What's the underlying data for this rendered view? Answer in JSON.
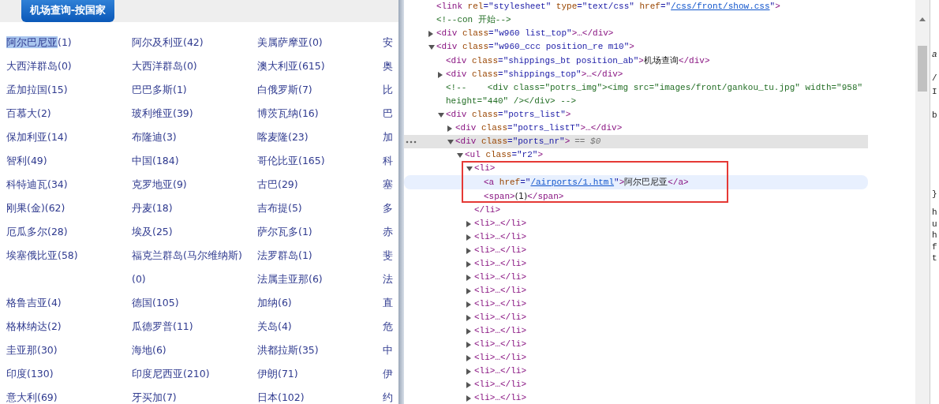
{
  "page": {
    "title_tab": "机场查询-按国家",
    "countries": [
      {
        "name": "阿尔巴尼亚",
        "count": "(1)",
        "selected": true
      },
      {
        "name": "阿尔及利亚",
        "count": "(42)",
        "selected": false
      },
      {
        "name": "美属萨摩亚",
        "count": "(0)",
        "selected": false
      },
      {
        "name": "安",
        "selected": false
      },
      {
        "name": "大西洋群岛",
        "count": "(0)",
        "selected": false
      },
      {
        "name": "大西洋群岛",
        "count": "(0)",
        "selected": false
      },
      {
        "name": "澳大利亚",
        "count": "(615)",
        "selected": false
      },
      {
        "name": "奥",
        "selected": false
      },
      {
        "name": "孟加拉国",
        "count": "(15)",
        "selected": false
      },
      {
        "name": "巴巴多斯",
        "count": "(1)",
        "selected": false
      },
      {
        "name": "白俄罗斯",
        "count": "(7)",
        "selected": false
      },
      {
        "name": "比",
        "selected": false
      },
      {
        "name": "百慕大",
        "count": "(2)",
        "selected": false
      },
      {
        "name": "玻利维亚",
        "count": "(39)",
        "selected": false
      },
      {
        "name": "博茨瓦纳",
        "count": "(16)",
        "selected": false
      },
      {
        "name": "巴",
        "selected": false
      },
      {
        "name": "保加利亚",
        "count": "(14)",
        "selected": false
      },
      {
        "name": "布隆迪",
        "count": "(3)",
        "selected": false
      },
      {
        "name": "喀麦隆",
        "count": "(23)",
        "selected": false
      },
      {
        "name": "加",
        "selected": false
      },
      {
        "name": "智利",
        "count": "(49)",
        "selected": false
      },
      {
        "name": "中国",
        "count": "(184)",
        "selected": false
      },
      {
        "name": "哥伦比亚",
        "count": "(165)",
        "selected": false
      },
      {
        "name": "科",
        "selected": false
      },
      {
        "name": "科特迪瓦",
        "count": "(34)",
        "selected": false
      },
      {
        "name": "克罗地亚",
        "count": "(9)",
        "selected": false
      },
      {
        "name": "古巴",
        "count": "(29)",
        "selected": false
      },
      {
        "name": "塞",
        "selected": false
      },
      {
        "name": "刚果(金)",
        "count": "(62)",
        "selected": false
      },
      {
        "name": "丹麦",
        "count": "(18)",
        "selected": false
      },
      {
        "name": "吉布提",
        "count": "(5)",
        "selected": false
      },
      {
        "name": "多",
        "selected": false
      },
      {
        "name": "厄瓜多尔",
        "count": "(28)",
        "selected": false
      },
      {
        "name": "埃及",
        "count": "(25)",
        "selected": false
      },
      {
        "name": "萨尔瓦多",
        "count": "(1)",
        "selected": false
      },
      {
        "name": "赤",
        "selected": false
      },
      {
        "name": "埃塞俄比亚",
        "count": "(58)",
        "selected": false
      },
      {
        "name": "福克兰群岛(马尔维纳斯)",
        "count": "(0)",
        "selected": false
      },
      {
        "name": "法罗群岛",
        "count": "(1)",
        "selected": false
      },
      {
        "name": "斐",
        "selected": false
      },
      {
        "name": "法属圭亚那",
        "count": "(6)",
        "selected": false
      },
      {
        "name": "法",
        "selected": false
      },
      {
        "name": "格鲁吉亚",
        "count": "(4)",
        "selected": false
      },
      {
        "name": "德国",
        "count": "(105)",
        "selected": false
      },
      {
        "name": "加纳",
        "count": "(6)",
        "selected": false
      },
      {
        "name": "直",
        "selected": false
      },
      {
        "name": "格林纳达",
        "count": "(2)",
        "selected": false
      },
      {
        "name": "瓜德罗普",
        "count": "(11)",
        "selected": false
      },
      {
        "name": "关岛",
        "count": "(4)",
        "selected": false
      },
      {
        "name": "危",
        "selected": false
      },
      {
        "name": "圭亚那",
        "count": "(30)",
        "selected": false
      },
      {
        "name": "海地",
        "count": "(6)",
        "selected": false
      },
      {
        "name": "洪都拉斯",
        "count": "(35)",
        "selected": false
      },
      {
        "name": "中",
        "selected": false
      },
      {
        "name": "印度",
        "count": "(130)",
        "selected": false
      },
      {
        "name": "印度尼西亚",
        "count": "(210)",
        "selected": false
      },
      {
        "name": "伊朗",
        "count": "(71)",
        "selected": false
      },
      {
        "name": "伊",
        "selected": false
      },
      {
        "name": "意大利",
        "count": "(69)",
        "selected": false
      },
      {
        "name": "牙买加",
        "count": "(7)",
        "selected": false
      },
      {
        "name": "日本",
        "count": "(102)",
        "selected": false
      },
      {
        "name": "约",
        "selected": false
      }
    ]
  },
  "devtools": {
    "dom": [
      {
        "kind": "element",
        "selected": false,
        "hovered": false,
        "parts": [
          {
            "kind": "tag",
            "text": "<link "
          },
          {
            "kind": "name",
            "text": "rel"
          },
          {
            "kind": "val",
            "text": "=\"stylesheet\""
          },
          {
            "kind": "name",
            "text": " type"
          },
          {
            "kind": "val",
            "text": "=\"text/css\""
          },
          {
            "kind": "name",
            "text": " href"
          },
          {
            "kind": "val",
            "text": "=\""
          },
          {
            "kind": "link",
            "text": "/css/front/show.css"
          },
          {
            "kind": "val",
            "text": "\""
          },
          {
            "kind": "tag",
            "text": ">"
          }
        ]
      },
      {
        "kind": "comment",
        "selected": false,
        "hovered": false,
        "parts": [
          {
            "kind": "comment",
            "text": "<!--con 开始-->"
          }
        ]
      },
      {
        "kind": "element",
        "expanded": false,
        "selected": false,
        "hovered": false,
        "parts": [
          {
            "kind": "tag",
            "text": "<div "
          },
          {
            "kind": "name",
            "text": "class"
          },
          {
            "kind": "val",
            "text": "=\"w960 list_top\""
          },
          {
            "kind": "tag",
            "text": ">…</div>"
          }
        ]
      },
      {
        "kind": "element",
        "expanded": true,
        "selected": false,
        "hovered": false,
        "parts": [
          {
            "kind": "tag",
            "text": "<div "
          },
          {
            "kind": "name",
            "text": "class"
          },
          {
            "kind": "val",
            "text": "=\"w960_ccc position_re m10\""
          },
          {
            "kind": "tag",
            "text": ">"
          }
        ],
        "children": [
          {
            "kind": "element",
            "selected": false,
            "hovered": false,
            "parts": [
              {
                "kind": "tag",
                "text": "<div "
              },
              {
                "kind": "name",
                "text": "class"
              },
              {
                "kind": "val",
                "text": "=\"shippings_bt position_ab\""
              },
              {
                "kind": "tag",
                "text": ">"
              },
              {
                "kind": "text",
                "text": "机场查询"
              },
              {
                "kind": "tag",
                "text": "</div>"
              }
            ]
          },
          {
            "kind": "element",
            "expanded": false,
            "selected": false,
            "hovered": false,
            "parts": [
              {
                "kind": "tag",
                "text": "<div "
              },
              {
                "kind": "name",
                "text": "class"
              },
              {
                "kind": "val",
                "text": "=\"shippings_top\""
              },
              {
                "kind": "tag",
                "text": ">…</div>"
              }
            ]
          },
          {
            "kind": "comment",
            "selected": false,
            "hovered": false,
            "parts": [
              {
                "kind": "comment",
                "text": "<!--    <div class=\"potrs_img\"><img src=\"images/front/gankou_tu.jpg\" width=\"958\" height=\"440\" /></div> -->"
              }
            ]
          },
          {
            "kind": "element",
            "expanded": true,
            "selected": false,
            "hovered": false,
            "parts": [
              {
                "kind": "tag",
                "text": "<div "
              },
              {
                "kind": "name",
                "text": "class"
              },
              {
                "kind": "val",
                "text": "=\"potrs_list\""
              },
              {
                "kind": "tag",
                "text": ">"
              }
            ],
            "children": [
              {
                "kind": "element",
                "expanded": false,
                "selected": false,
                "hovered": false,
                "parts": [
                  {
                    "kind": "tag",
                    "text": "<div "
                  },
                  {
                    "kind": "name",
                    "text": "class"
                  },
                  {
                    "kind": "val",
                    "text": "=\"potrs_listT\""
                  },
                  {
                    "kind": "tag",
                    "text": ">…</div>"
                  }
                ]
              },
              {
                "kind": "element",
                "expanded": true,
                "selected": true,
                "hovered": false,
                "suffix": "== $0",
                "parts": [
                  {
                    "kind": "tag",
                    "text": "<div "
                  },
                  {
                    "kind": "name",
                    "text": "class"
                  },
                  {
                    "kind": "val",
                    "text": "=\"ports_nr\""
                  },
                  {
                    "kind": "tag",
                    "text": ">"
                  }
                ],
                "children": [
                  {
                    "kind": "element",
                    "expanded": true,
                    "selected": false,
                    "hovered": false,
                    "parts": [
                      {
                        "kind": "tag",
                        "text": "<ul "
                      },
                      {
                        "kind": "name",
                        "text": "class"
                      },
                      {
                        "kind": "val",
                        "text": "=\"r2\""
                      },
                      {
                        "kind": "tag",
                        "text": ">"
                      }
                    ],
                    "children": [
                      {
                        "kind": "element",
                        "expanded": true,
                        "selected": false,
                        "hovered": false,
                        "highlighted": true,
                        "parts": [
                          {
                            "kind": "tag",
                            "text": "<li>"
                          }
                        ],
                        "children": [
                          {
                            "kind": "element",
                            "selected": false,
                            "hovered": true,
                            "parts": [
                              {
                                "kind": "tag",
                                "text": "<a "
                              },
                              {
                                "kind": "name",
                                "text": "href"
                              },
                              {
                                "kind": "val",
                                "text": "=\""
                              },
                              {
                                "kind": "link",
                                "text": "/airports/1.html"
                              },
                              {
                                "kind": "val",
                                "text": "\""
                              },
                              {
                                "kind": "tag",
                                "text": ">"
                              },
                              {
                                "kind": "text",
                                "text": "阿尔巴尼亚"
                              },
                              {
                                "kind": "tag",
                                "text": "</a>"
                              }
                            ]
                          },
                          {
                            "kind": "element",
                            "selected": false,
                            "hovered": false,
                            "parts": [
                              {
                                "kind": "tag",
                                "text": "<span>"
                              },
                              {
                                "kind": "text",
                                "text": "(1)"
                              },
                              {
                                "kind": "tag",
                                "text": "</span>"
                              }
                            ]
                          },
                          {
                            "kind": "close",
                            "selected": false,
                            "hovered": false,
                            "parts": [
                              {
                                "kind": "tag",
                                "text": "</li>"
                              }
                            ]
                          }
                        ]
                      },
                      {
                        "kind": "element",
                        "expanded": false,
                        "selected": false,
                        "hovered": false,
                        "parts": [
                          {
                            "kind": "tag",
                            "text": "<li>…</li>"
                          }
                        ]
                      },
                      {
                        "kind": "element",
                        "expanded": false,
                        "selected": false,
                        "hovered": false,
                        "parts": [
                          {
                            "kind": "tag",
                            "text": "<li>…</li>"
                          }
                        ]
                      },
                      {
                        "kind": "element",
                        "expanded": false,
                        "selected": false,
                        "hovered": false,
                        "parts": [
                          {
                            "kind": "tag",
                            "text": "<li>…</li>"
                          }
                        ]
                      },
                      {
                        "kind": "element",
                        "expanded": false,
                        "selected": false,
                        "hovered": false,
                        "parts": [
                          {
                            "kind": "tag",
                            "text": "<li>…</li>"
                          }
                        ]
                      },
                      {
                        "kind": "element",
                        "expanded": false,
                        "selected": false,
                        "hovered": false,
                        "parts": [
                          {
                            "kind": "tag",
                            "text": "<li>…</li>"
                          }
                        ]
                      },
                      {
                        "kind": "element",
                        "expanded": false,
                        "selected": false,
                        "hovered": false,
                        "parts": [
                          {
                            "kind": "tag",
                            "text": "<li>…</li>"
                          }
                        ]
                      },
                      {
                        "kind": "element",
                        "expanded": false,
                        "selected": false,
                        "hovered": false,
                        "parts": [
                          {
                            "kind": "tag",
                            "text": "<li>…</li>"
                          }
                        ]
                      },
                      {
                        "kind": "element",
                        "expanded": false,
                        "selected": false,
                        "hovered": false,
                        "parts": [
                          {
                            "kind": "tag",
                            "text": "<li>…</li>"
                          }
                        ]
                      },
                      {
                        "kind": "element",
                        "expanded": false,
                        "selected": false,
                        "hovered": false,
                        "parts": [
                          {
                            "kind": "tag",
                            "text": "<li>…</li>"
                          }
                        ]
                      },
                      {
                        "kind": "element",
                        "expanded": false,
                        "selected": false,
                        "hovered": false,
                        "parts": [
                          {
                            "kind": "tag",
                            "text": "<li>…</li>"
                          }
                        ]
                      },
                      {
                        "kind": "element",
                        "expanded": false,
                        "selected": false,
                        "hovered": false,
                        "parts": [
                          {
                            "kind": "tag",
                            "text": "<li>…</li>"
                          }
                        ]
                      },
                      {
                        "kind": "element",
                        "expanded": false,
                        "selected": false,
                        "hovered": false,
                        "parts": [
                          {
                            "kind": "tag",
                            "text": "<li>…</li>"
                          }
                        ]
                      },
                      {
                        "kind": "element",
                        "expanded": false,
                        "selected": false,
                        "hovered": false,
                        "parts": [
                          {
                            "kind": "tag",
                            "text": "<li>…</li>"
                          }
                        ]
                      },
                      {
                        "kind": "element",
                        "expanded": false,
                        "selected": false,
                        "hovered": false,
                        "parts": [
                          {
                            "kind": "tag",
                            "text": "<li>…</li>"
                          }
                        ]
                      }
                    ]
                  }
                ]
              }
            ]
          }
        ]
      }
    ],
    "styles_fragments": [
      "a",
      "/",
      "I",
      "b",
      "}",
      "h",
      "u",
      "h",
      "f",
      "t"
    ]
  }
}
